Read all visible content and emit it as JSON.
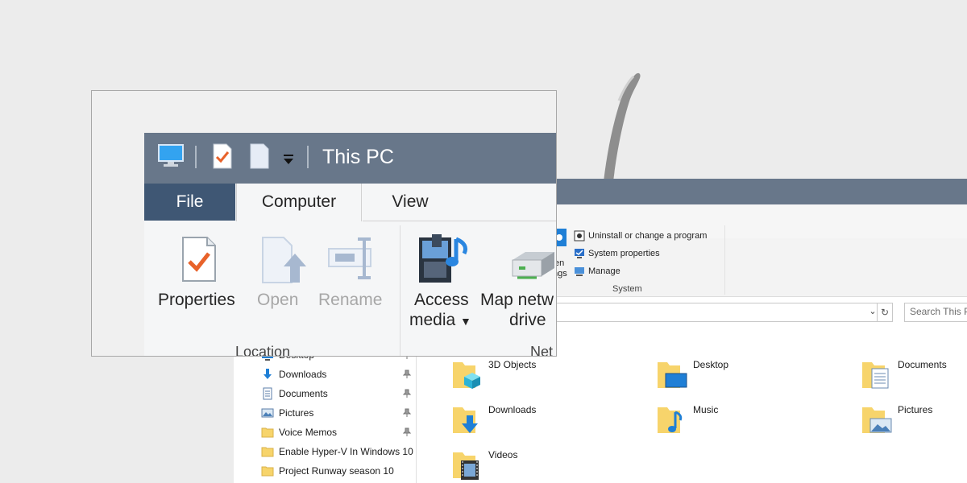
{
  "front_window": {
    "title": "This PC",
    "tabs": [
      {
        "label": "File"
      },
      {
        "label": "Computer"
      },
      {
        "label": "View"
      }
    ],
    "buttons": {
      "properties": "Properties",
      "open": "Open",
      "rename": "Rename",
      "access_media": "Access",
      "access_media_line2": "media",
      "map_network": "Map netw",
      "map_network_line2": "drive"
    },
    "groups": {
      "location": "Location",
      "network": "Net"
    }
  },
  "back_window": {
    "ribbon": {
      "open_settings_partial_1": "en",
      "open_settings_partial_2": "ngs",
      "system_items": [
        {
          "label": "Uninstall or change a program",
          "icon": "uninstall-icon"
        },
        {
          "label": "System properties",
          "icon": "system-properties-icon"
        },
        {
          "label": "Manage",
          "icon": "manage-icon"
        }
      ],
      "group_label": "System"
    },
    "search": {
      "placeholder": "Search This PC"
    },
    "nav_items": [
      {
        "label": "Desktop",
        "icon": "desktop-icon",
        "pinned": true
      },
      {
        "label": "Downloads",
        "icon": "downloads-icon",
        "pinned": true
      },
      {
        "label": "Documents",
        "icon": "documents-icon",
        "pinned": true
      },
      {
        "label": "Pictures",
        "icon": "pictures-icon",
        "pinned": true
      },
      {
        "label": "Voice Memos",
        "icon": "folder-icon",
        "pinned": true
      },
      {
        "label": "Enable Hyper-V In Windows 10",
        "icon": "folder-icon",
        "pinned": false
      },
      {
        "label": "Project Runway season 10",
        "icon": "folder-icon",
        "pinned": false
      }
    ],
    "folders": [
      {
        "label": "3D Objects",
        "icon": "3d-objects-folder-icon"
      },
      {
        "label": "Desktop",
        "icon": "desktop-folder-icon"
      },
      {
        "label": "Documents",
        "icon": "documents-folder-icon"
      },
      {
        "label": "Downloads",
        "icon": "downloads-folder-icon"
      },
      {
        "label": "Music",
        "icon": "music-folder-icon"
      },
      {
        "label": "Pictures",
        "icon": "pictures-folder-icon"
      },
      {
        "label": "Videos",
        "icon": "videos-folder-icon"
      }
    ]
  },
  "colors": {
    "titlebar": "#68778a",
    "file_tab": "#3f5774",
    "ribbon_bg": "#f5f6f7",
    "folder_yellow": "#f7d46b",
    "accent_blue": "#1f7fd6"
  }
}
